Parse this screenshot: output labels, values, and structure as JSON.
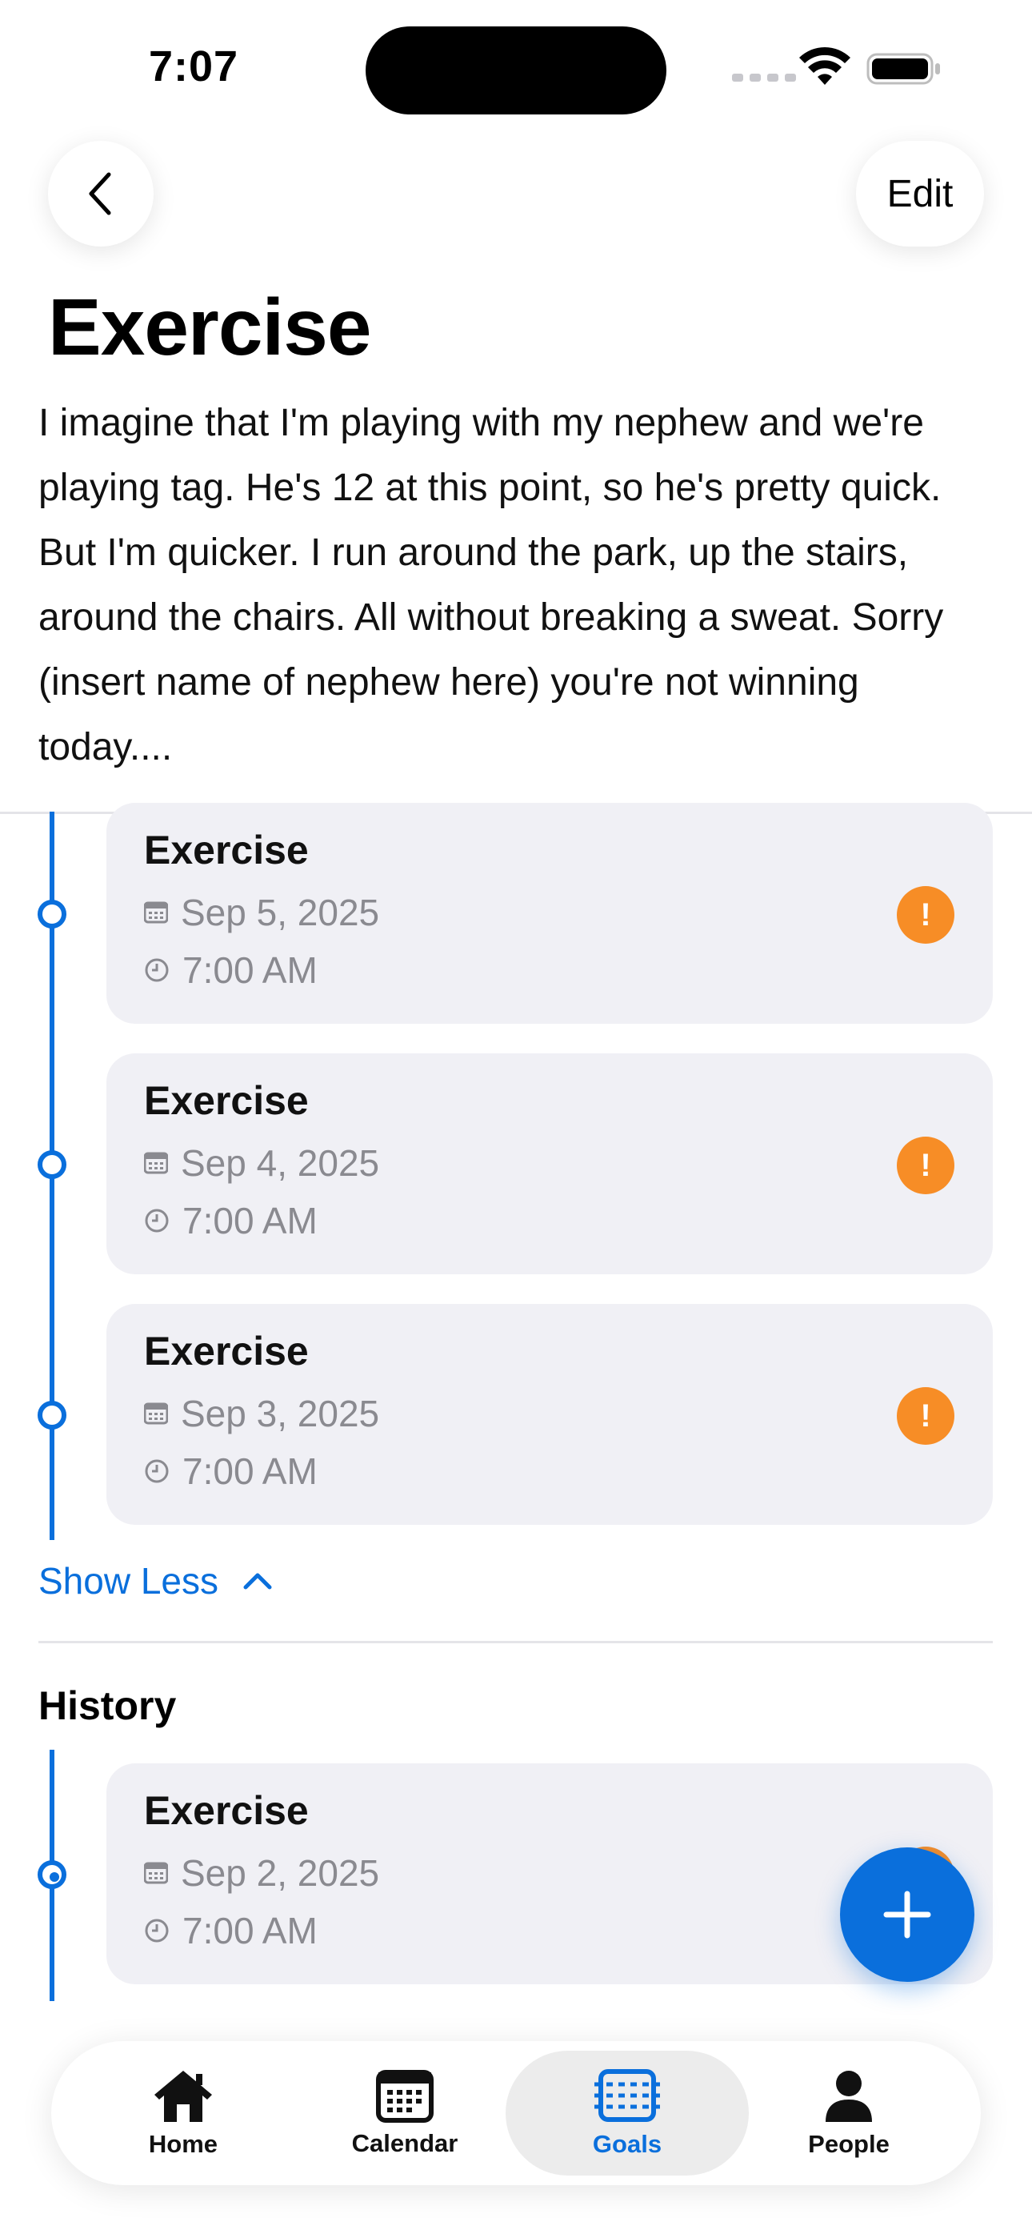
{
  "status_bar": {
    "time": "7:07"
  },
  "header": {
    "back_icon": "chevron-left-icon",
    "edit_label": "Edit",
    "title": "Exercise",
    "description": "I imagine that I'm playing with my nephew and we're playing tag. He's 12 at this point, so he's pretty quick. But I'm quicker. I run around the park, up the stairs, around the chairs. All without breaking a sweat. Sorry (insert name of nephew here) you're not winning today...."
  },
  "upcoming": [
    {
      "title": "Exercise",
      "date": "Sep 5, 2025",
      "time": "7:00 AM",
      "alert": "!"
    },
    {
      "title": "Exercise",
      "date": "Sep 4, 2025",
      "time": "7:00 AM",
      "alert": "!"
    },
    {
      "title": "Exercise",
      "date": "Sep 3, 2025",
      "time": "7:00 AM",
      "alert": "!"
    }
  ],
  "show_less_label": "Show Less",
  "history": {
    "title": "History",
    "items": [
      {
        "title": "Exercise",
        "date": "Sep 2, 2025",
        "time": "7:00 AM"
      }
    ]
  },
  "tabs": [
    {
      "label": "Home",
      "icon": "house-icon"
    },
    {
      "label": "Calendar",
      "icon": "calendar-icon"
    },
    {
      "label": "Goals",
      "icon": "goals-icon",
      "active": true
    },
    {
      "label": "People",
      "icon": "person-icon"
    }
  ],
  "colors": {
    "accent": "#0a6fdc",
    "alert": "#f78d26",
    "card": "#f0f0f5"
  }
}
